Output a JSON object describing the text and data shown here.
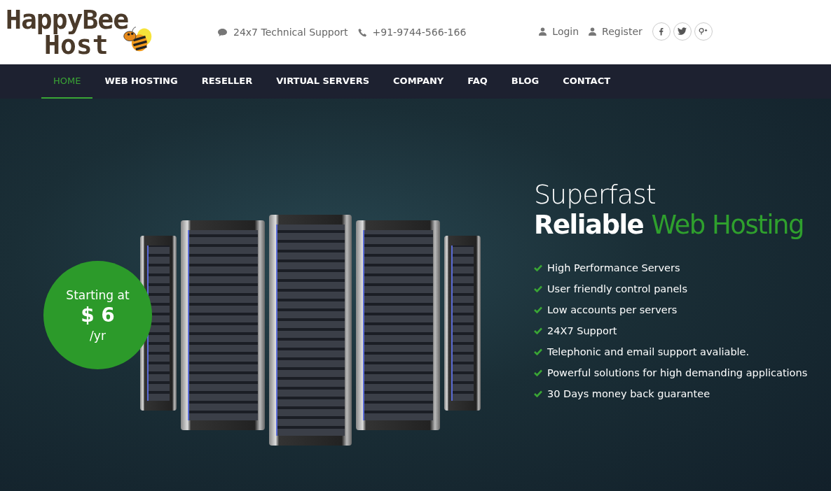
{
  "logo": {
    "line_1": "HappyBee",
    "line_2": "Host"
  },
  "contact": {
    "support": "24x7 Technical Support",
    "phone": "+91-9744-566-166"
  },
  "account_links": [
    "Login",
    "Register"
  ],
  "nav": [
    {
      "label": "HOME",
      "selected": true
    },
    {
      "label": "WEB HOSTING",
      "selected": false
    },
    {
      "label": "RESELLER",
      "selected": false
    },
    {
      "label": "VIRTUAL SERVERS",
      "selected": false
    },
    {
      "label": "COMPANY",
      "selected": false
    },
    {
      "label": "FAQ",
      "selected": false
    },
    {
      "label": "BLOG",
      "selected": false
    },
    {
      "label": "CONTACT",
      "selected": false
    }
  ],
  "price_badge": {
    "prefix": "Starting at",
    "price": "$ 6",
    "period": "/yr"
  },
  "hero": {
    "line_1": "Superfast",
    "line_2": [
      {
        "text": "Reliable",
        "accent": false
      },
      {
        "text": "Web Hosting",
        "accent": true
      }
    ],
    "features": [
      "High Performance Servers",
      "User friendly control panels",
      "Low accounts per servers",
      "24X7 Support",
      "Telephonic and email support avaliable.",
      "Powerful solutions for high demanding applications",
      "30 Days money back guarantee"
    ]
  }
}
